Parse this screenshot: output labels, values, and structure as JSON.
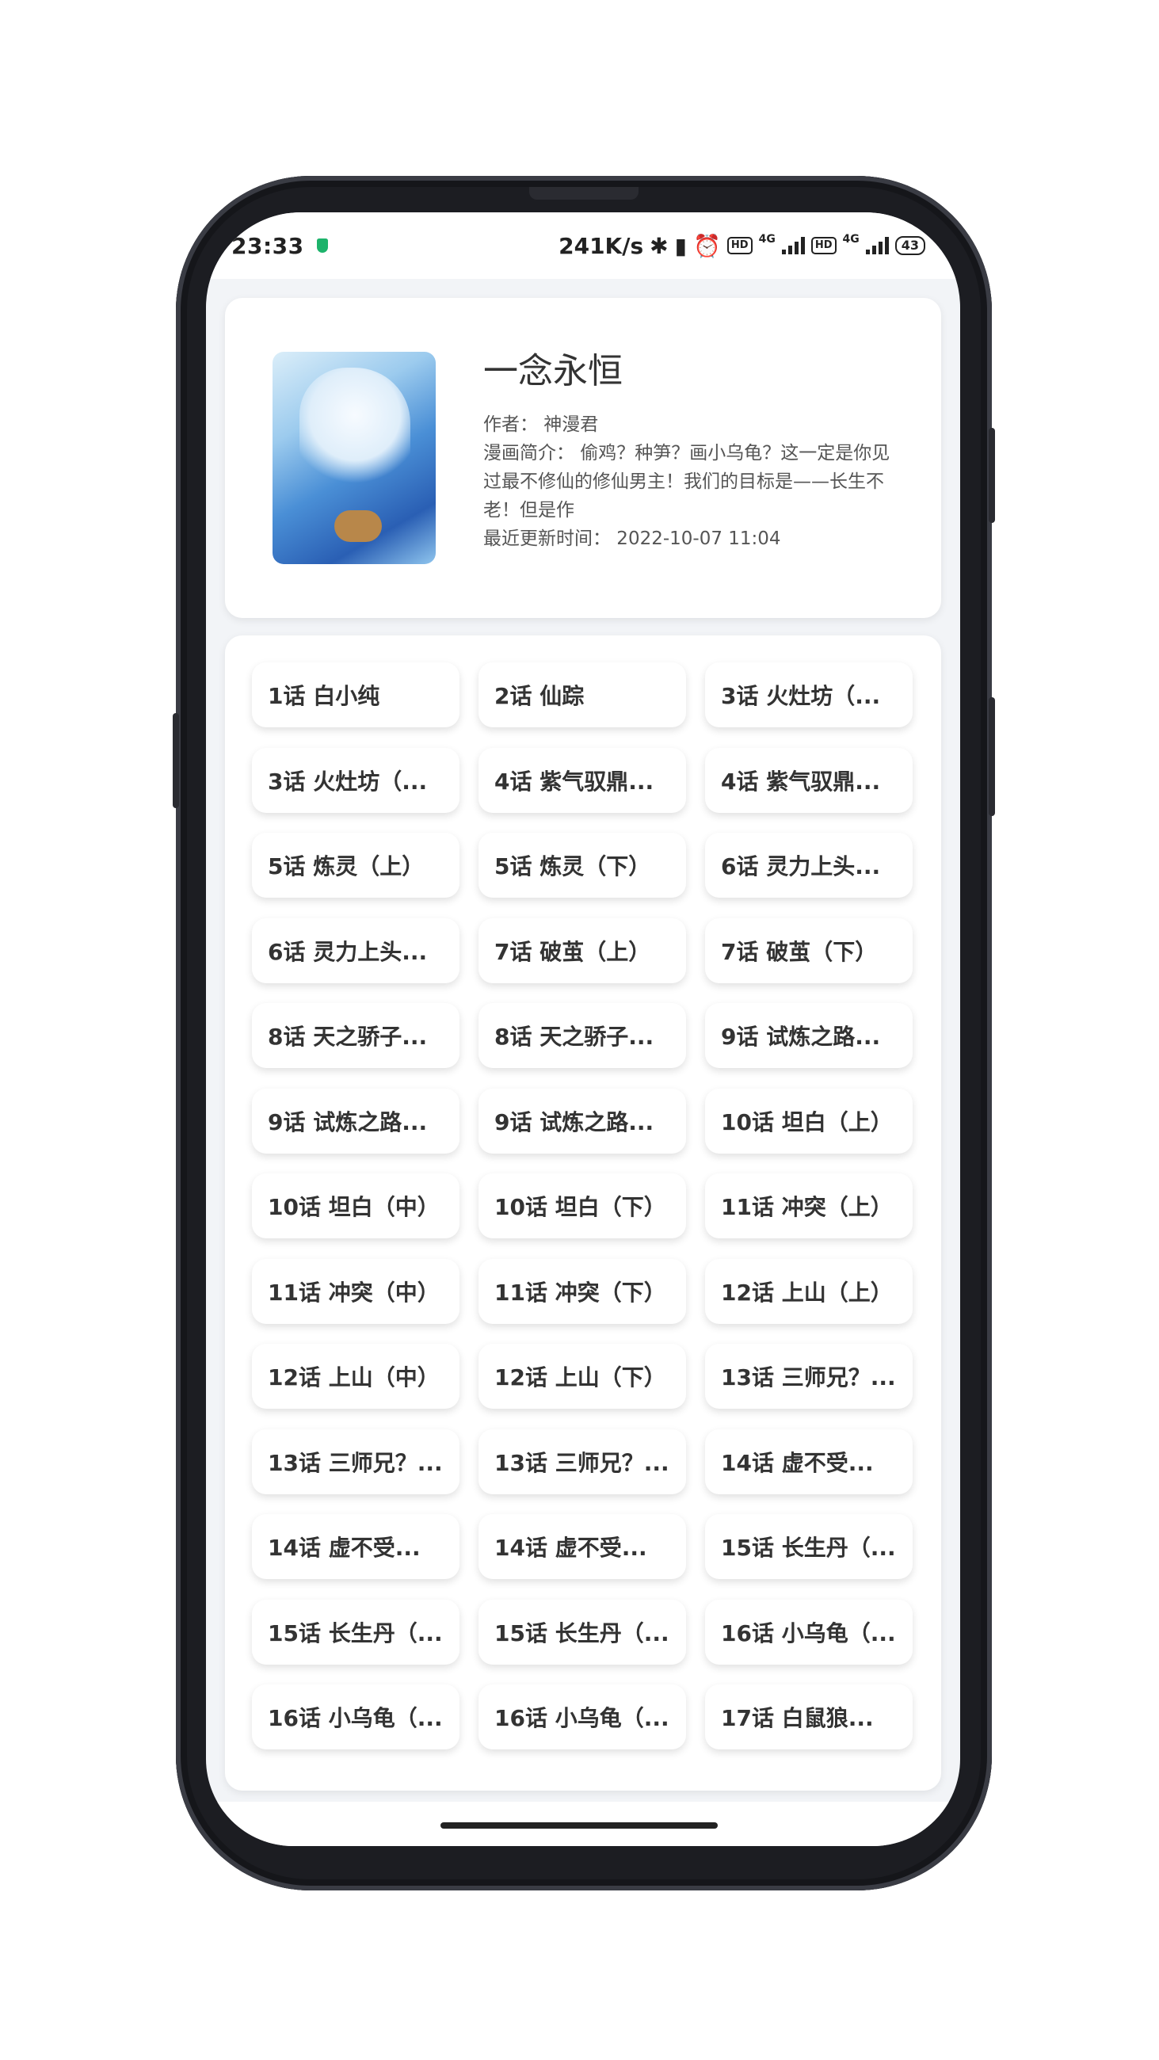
{
  "status_bar": {
    "time": "23:33",
    "speed": "241K/s",
    "network1": "4G",
    "network2": "4G",
    "hd": "HD",
    "battery": "43"
  },
  "comic": {
    "title": "一念永恒",
    "author": "作者：  神漫君",
    "summary": "漫画简介：  偷鸡？种笋？画小乌龟？这一定是你见过最不修仙的修仙男主！我们的目标是——长生不老！但是作",
    "updated": "最近更新时间：  2022-10-07 11:04"
  },
  "chapters": [
    "1话 白小纯",
    "2话 仙踪",
    "3话 火灶坊（...",
    "3话 火灶坊（...",
    "4话 紫气驭鼎...",
    "4话 紫气驭鼎...",
    "5话 炼灵（上）",
    "5话 炼灵（下）",
    "6话 灵力上头...",
    "6话 灵力上头...",
    "7话 破茧（上）",
    "7话 破茧（下）",
    "8话 天之骄子...",
    "8话 天之骄子...",
    "9话 试炼之路...",
    "9话 试炼之路...",
    "9话 试炼之路...",
    "10话 坦白（上）",
    "10话 坦白（中）",
    "10话 坦白（下）",
    "11话 冲突（上）",
    "11话 冲突（中）",
    "11话 冲突（下）",
    "12话 上山（上）",
    "12话 上山（中）",
    "12话 上山（下）",
    "13话 三师兄？...",
    "13话 三师兄？...",
    "13话 三师兄？...",
    "14话 虚不受...",
    "14话 虚不受...",
    "14话 虚不受...",
    "15话 长生丹（...",
    "15话 长生丹（...",
    "15话 长生丹（...",
    "16话 小乌龟（...",
    "16话 小乌龟（...",
    "16话 小乌龟（...",
    "17话 白鼠狼..."
  ],
  "colors": {
    "background": "#f2f4f7",
    "card": "#ffffff",
    "text": "#333333",
    "shield": "#1db36b"
  }
}
